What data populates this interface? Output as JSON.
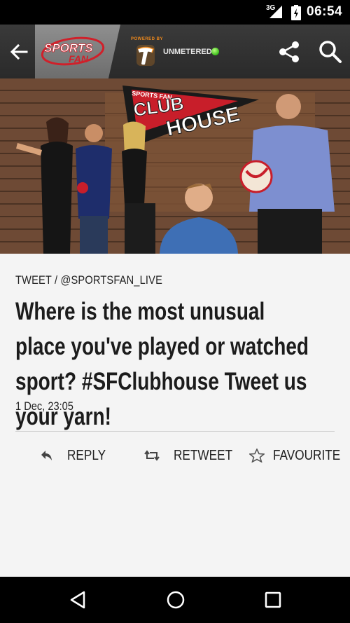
{
  "status_bar": {
    "network": "3G",
    "time": "06:54"
  },
  "app_bar": {
    "logo_text_1": "SPORTS",
    "logo_text_2": "FAN",
    "powered_by": "POWERED BY",
    "unmetered": "UNMETERED",
    "unmetered_dot_color": "#3cbf1c",
    "brand_red": "#d0202a"
  },
  "hero": {
    "pennant_top": "SPORTS FAN",
    "pennant_line_1": "CLUB",
    "pennant_line_2": "HOUSE"
  },
  "tweet": {
    "source": "TWEET / @SPORTSFAN_LIVE",
    "text": "Where is the most unusual place you've played or watched sport? #SFClubhouse Tweet us your yarn!",
    "date": "1 Dec, 23:05"
  },
  "actions": {
    "reply": "REPLY",
    "retweet": "RETWEET",
    "favourite": "FAVOURITE"
  },
  "icons": [
    "back-arrow-icon",
    "share-icon",
    "search-icon",
    "reply-icon",
    "retweet-icon",
    "star-icon",
    "nav-back-icon",
    "nav-home-icon",
    "nav-recents-icon"
  ]
}
